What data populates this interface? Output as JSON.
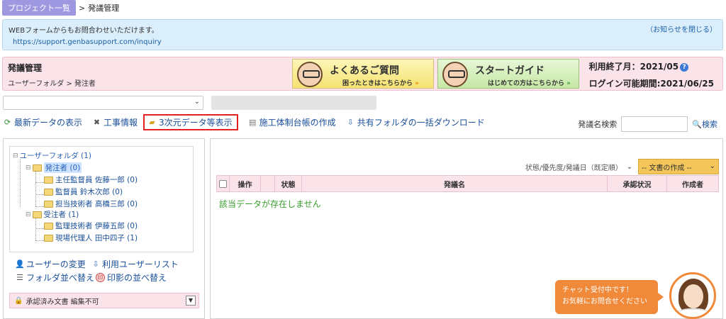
{
  "breadcrumb": {
    "link": "プロジェクト一覧",
    "sep": ">",
    "current": "発議管理"
  },
  "notice": {
    "message": "WEBフォームからもお問合わせいただけます。",
    "url": "https://support.genbasupport.com/inquiry",
    "close": "（お知らせを閉じる）"
  },
  "header": {
    "title": "発議管理",
    "sub": "ユーザーフォルダ > 発注者",
    "faq_title": "よくあるご質問",
    "faq_sub": "困ったときはこちらから",
    "guide_title": "スタートガイド",
    "guide_sub": "はじめての方はこちらから",
    "arrow": "»",
    "end_label": "利用終了月：2021/05",
    "login_label": "ログイン可能期間:2021/06/25",
    "help_icon": "?"
  },
  "toolbar": {
    "latest": "最新データの表示",
    "work": "工事情報",
    "threed": "3次元データ等表示",
    "ledger": "施工体制台帳の作成",
    "download": "共有フォルダの一括ダウンロード"
  },
  "search": {
    "label": "発議名検索",
    "button": "検索"
  },
  "tree": {
    "root": "ユーザーフォルダ (1)",
    "orderer": "発注者 (0)",
    "o1": "主任監督員 佐藤一郎 (0)",
    "o2": "監督員 鈴木次郎 (0)",
    "o3": "担当技術者 高橋三郎 (0)",
    "contractor": "受注者 (1)",
    "c1": "監理技術者 伊藤五郎 (0)",
    "c2": "現場代理人 田中四子 (1)"
  },
  "left_menu": {
    "change_user": "ユーザーの変更",
    "user_list": "利用ユーザーリスト",
    "folder_sort": "フォルダ並べ替え",
    "seal_sort": "印影の並べ替え",
    "seal_char": "印",
    "approved": "承認済み文書 編集不可"
  },
  "list": {
    "sort": "状態/優先度/発議日（既定順）",
    "create": "-- 文書の作成 --",
    "columns": [
      "操作",
      "状態",
      "発議名",
      "承認状況",
      "作成者"
    ],
    "empty": "該当データが存在しません"
  },
  "chat": {
    "line1": "チャット受付中です！",
    "line2": "お気軽にお問合せください"
  }
}
